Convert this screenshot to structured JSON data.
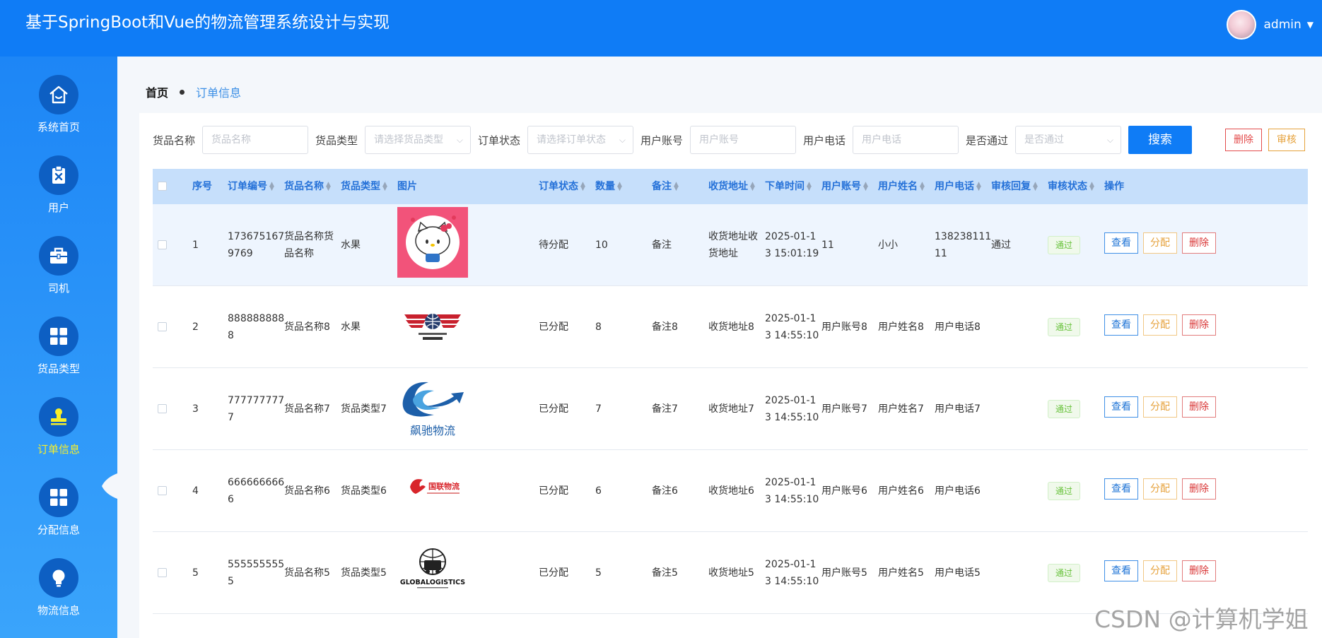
{
  "header": {
    "title": "基于SpringBoot和Vue的物流管理系统设计与实现",
    "username": "admin"
  },
  "sidebar": {
    "items": [
      {
        "label": "系统首页",
        "icon": "home-icon"
      },
      {
        "label": "用户",
        "icon": "clipboard-x-icon"
      },
      {
        "label": "司机",
        "icon": "briefcase-icon"
      },
      {
        "label": "货品类型",
        "icon": "grid-icon"
      },
      {
        "label": "订单信息",
        "icon": "stamp-icon",
        "active": true
      },
      {
        "label": "分配信息",
        "icon": "grid-icon"
      },
      {
        "label": "物流信息",
        "icon": "lightbulb-icon"
      }
    ]
  },
  "breadcrumb": {
    "home": "首页",
    "current": "订单信息"
  },
  "filters": {
    "goods_name": {
      "label": "货品名称",
      "placeholder": "货品名称"
    },
    "goods_type": {
      "label": "货品类型",
      "placeholder": "请选择货品类型"
    },
    "order_status": {
      "label": "订单状态",
      "placeholder": "请选择订单状态"
    },
    "user_account": {
      "label": "用户账号",
      "placeholder": "用户账号"
    },
    "user_phone": {
      "label": "用户电话",
      "placeholder": "用户电话"
    },
    "approved": {
      "label": "是否通过",
      "placeholder": "是否通过"
    },
    "search_label": "搜索",
    "delete_label": "删除",
    "audit_label": "审核"
  },
  "table": {
    "headers": [
      "序号",
      "订单编号",
      "货品名称",
      "货品类型",
      "图片",
      "订单状态",
      "数量",
      "备注",
      "收货地址",
      "下单时间",
      "用户账号",
      "用户姓名",
      "用户电话",
      "审核回复",
      "审核状态",
      "操作"
    ],
    "rows": [
      {
        "index": "1",
        "order_no": [
          "173675167",
          "9769"
        ],
        "goods_name": [
          "货品名称货",
          "品名称"
        ],
        "goods_type": "水果",
        "image": "hello-kitty",
        "status": "待分配",
        "qty": "10",
        "remark": "备注",
        "address": [
          "收货地址收",
          "货地址"
        ],
        "time": [
          "2025-01-1",
          "3 15:01:19"
        ],
        "account": "11",
        "user_name": "小小",
        "phone": [
          "138238111",
          "11"
        ],
        "reply": "通过",
        "audit": "通过"
      },
      {
        "index": "2",
        "order_no": [
          "888888888",
          "8"
        ],
        "goods_name": [
          "货品名称8"
        ],
        "goods_type": "水果",
        "image": "wings-globe-logo",
        "status": "已分配",
        "qty": "8",
        "remark": "备注8",
        "address": [
          "收货地址8"
        ],
        "time": [
          "2025-01-1",
          "3 14:55:10"
        ],
        "account": "用户账号8",
        "user_name": "用户姓名8",
        "phone": [
          "用户电话8"
        ],
        "reply": "",
        "audit": "通过"
      },
      {
        "index": "3",
        "order_no": [
          "777777777",
          "7"
        ],
        "goods_name": [
          "货品名称7"
        ],
        "goods_type": "货品类型7",
        "image": "swoosh-logo",
        "image_text": "飙驰物流",
        "status": "已分配",
        "qty": "7",
        "remark": "备注7",
        "address": [
          "收货地址7"
        ],
        "time": [
          "2025-01-1",
          "3 14:55:10"
        ],
        "account": "用户账号7",
        "user_name": "用户姓名7",
        "phone": [
          "用户电话7"
        ],
        "reply": "",
        "audit": "通过"
      },
      {
        "index": "4",
        "order_no": [
          "666666666",
          "6"
        ],
        "goods_name": [
          "货品名称6"
        ],
        "goods_type": "货品类型6",
        "image": "red-bird-logo",
        "image_text": "国联物流",
        "status": "已分配",
        "qty": "6",
        "remark": "备注6",
        "address": [
          "收货地址6"
        ],
        "time": [
          "2025-01-1",
          "3 14:55:10"
        ],
        "account": "用户账号6",
        "user_name": "用户姓名6",
        "phone": [
          "用户电话6"
        ],
        "reply": "",
        "audit": "通过"
      },
      {
        "index": "5",
        "order_no": [
          "555555555",
          "5"
        ],
        "goods_name": [
          "货品名称5"
        ],
        "goods_type": "货品类型5",
        "image": "globalogistics-logo",
        "image_text": "GLOBALOGISTICS",
        "status": "已分配",
        "qty": "5",
        "remark": "备注5",
        "address": [
          "收货地址5"
        ],
        "time": [
          "2025-01-1",
          "3 14:55:10"
        ],
        "account": "用户账号5",
        "user_name": "用户姓名5",
        "phone": [
          "用户电话5"
        ],
        "reply": "",
        "audit": "通过"
      }
    ],
    "actions": {
      "view": "查看",
      "assign": "分配",
      "delete": "删除"
    }
  },
  "watermark": "CSDN @计算机学姐",
  "colors": {
    "header": "#0f7cf6",
    "sidebar_top": "#1d86f6",
    "sidebar_bottom": "#3aa4fb",
    "active_label": "#f7ef2b",
    "table_header": "#c6dffb"
  }
}
